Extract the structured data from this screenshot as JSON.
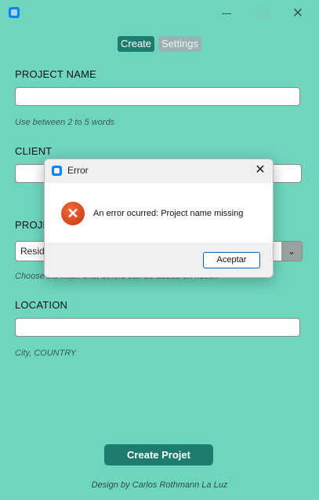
{
  "window": {
    "minimize_icon": "minimize-icon",
    "maximize_icon": "maximize-icon",
    "close_glyph": "✕"
  },
  "tabs": [
    {
      "label": "Create",
      "active": true
    },
    {
      "label": "Settings",
      "active": false
    }
  ],
  "form": {
    "project_name": {
      "label": "PROJECT NAME",
      "value": "",
      "hint": "Use between 2 to 5 words"
    },
    "client": {
      "label": "CLIENT",
      "value": ""
    },
    "project_type": {
      "label": "PROJE",
      "selected": "Resid",
      "hint": "Choose the main one, others can be added on notion"
    },
    "location": {
      "label": "LOCATION",
      "value": "",
      "hint": "City, COUNTRY"
    },
    "submit_label": "Create Projet"
  },
  "footer": {
    "text": "Design by Carlos Rothmann La Luz"
  },
  "dialog": {
    "title": "Error",
    "close_glyph": "✕",
    "error_glyph": "✕",
    "message": "An error ocurred: Project name missing",
    "accept_label": "Aceptar"
  },
  "colors": {
    "background": "#6fd6be",
    "accent": "#1d7c6d",
    "error": "#c8340e"
  }
}
